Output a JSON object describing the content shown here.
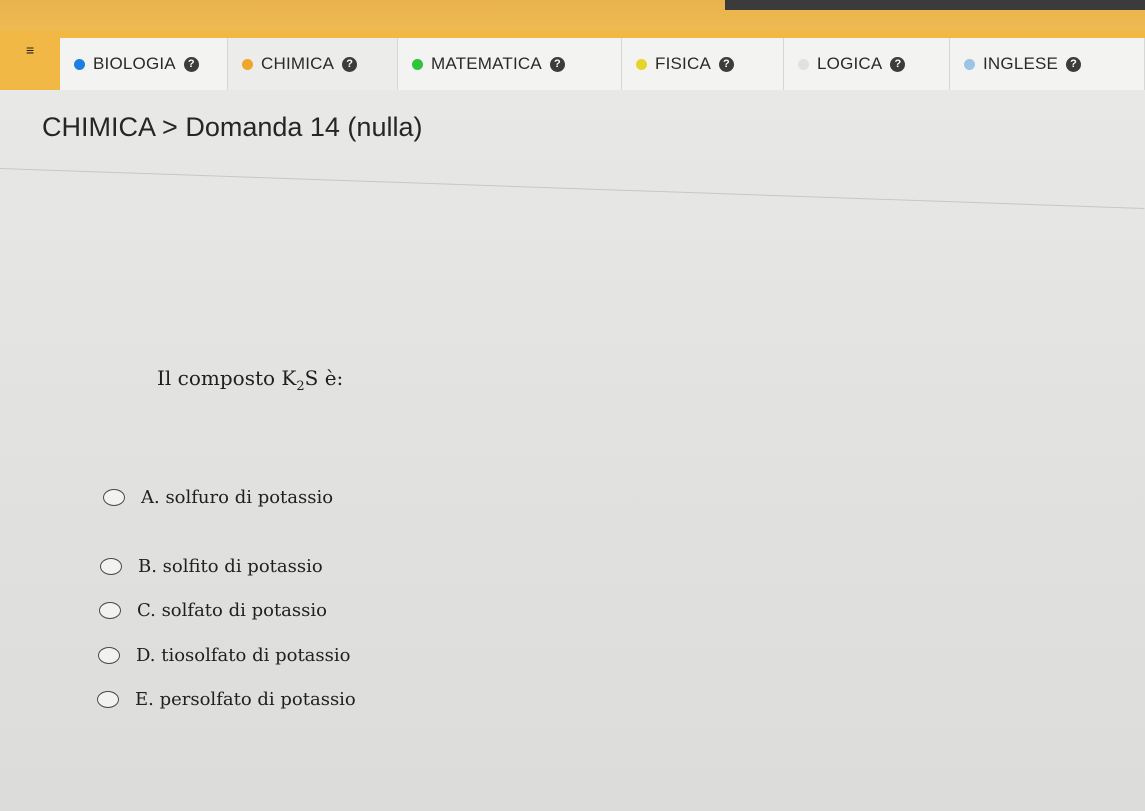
{
  "header": {
    "menu_icon": "hamburger-icon",
    "tabs": [
      {
        "label": "BIOLOGIA",
        "dot_color": "#1e7fe0",
        "active": false
      },
      {
        "label": "CHIMICA",
        "dot_color": "#f0a62a",
        "active": true
      },
      {
        "label": "MATEMATICA",
        "dot_color": "#2ec43b",
        "active": false
      },
      {
        "label": "FISICA",
        "dot_color": "#e6d42a",
        "active": false
      },
      {
        "label": "LOGICA",
        "dot_color": "#e1e1df",
        "active": false
      },
      {
        "label": "INGLESE",
        "dot_color": "#9cc4e4",
        "active": false
      }
    ],
    "info_glyph": "?"
  },
  "breadcrumb": {
    "subject": "CHIMICA",
    "separator": ">",
    "question": "Domanda 14 (nulla)"
  },
  "question": {
    "prefix": "Il composto",
    "formula_main": "K",
    "formula_sub": "2",
    "formula_end": "S",
    "suffix": "è:"
  },
  "options": [
    {
      "text": "A. solfuro di potassio"
    },
    {
      "text": "B. solfito di potassio"
    },
    {
      "text": "C. solfato di potassio"
    },
    {
      "text": "D. tiosolfato di potassio"
    },
    {
      "text": "E. persolfato di potassio"
    }
  ]
}
